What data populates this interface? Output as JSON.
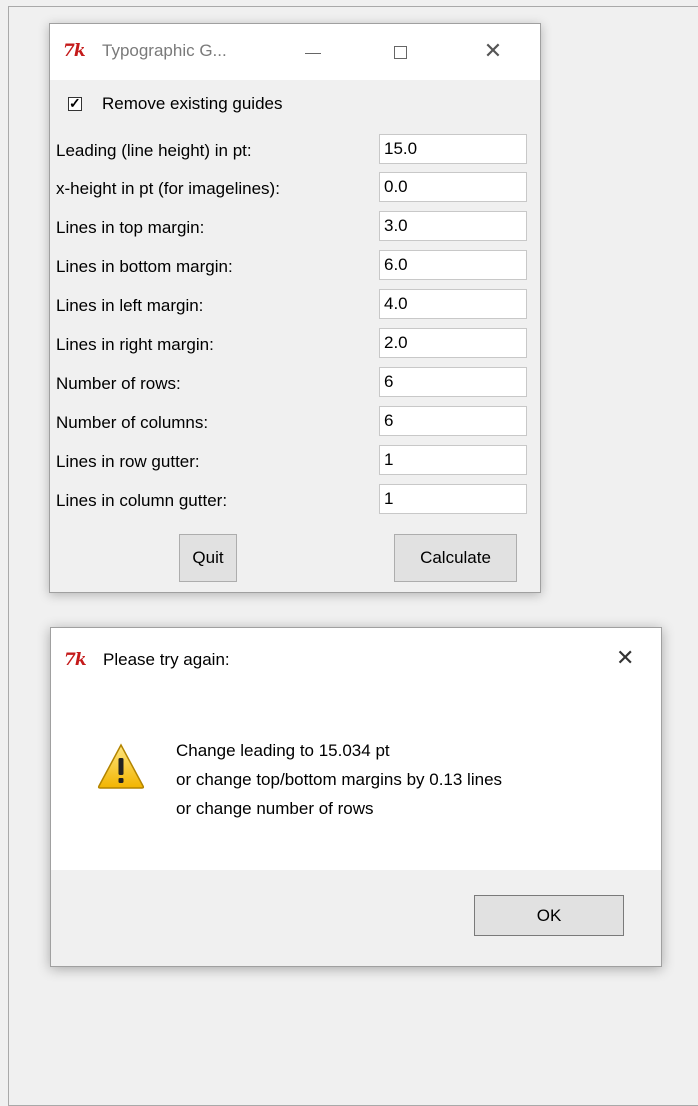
{
  "main_window": {
    "logo": "7k",
    "title": "Typographic G...",
    "remove_guides_label": "Remove existing guides",
    "remove_guides_checked": true,
    "fields": [
      {
        "label": "Leading (line height) in pt:",
        "value": "15.0"
      },
      {
        "label": "x-height in pt (for imagelines):",
        "value": "0.0"
      },
      {
        "label": "Lines in top margin:",
        "value": "3.0"
      },
      {
        "label": "Lines in bottom margin:",
        "value": "6.0"
      },
      {
        "label": "Lines in left margin:",
        "value": "4.0"
      },
      {
        "label": "Lines in right margin:",
        "value": "2.0"
      },
      {
        "label": "Number of rows:",
        "value": "6"
      },
      {
        "label": "Number of columns:",
        "value": "6"
      },
      {
        "label": "Lines in row gutter:",
        "value": "1"
      },
      {
        "label": "Lines in column gutter:",
        "value": "1"
      }
    ],
    "quit_label": "Quit",
    "calculate_label": "Calculate"
  },
  "dialog": {
    "logo": "7k",
    "title": "Please try again:",
    "close_glyph": "✕",
    "messages": [
      "Change leading to 15.034 pt",
      "or change top/bottom margins by 0.13 lines",
      "or change number of rows"
    ],
    "ok_label": "OK"
  },
  "icons": {
    "warning": "warning-icon",
    "app": "tk-feather-icon"
  },
  "colors": {
    "tk_logo": "#c41a1a",
    "warning_fill": "#f2c200"
  }
}
